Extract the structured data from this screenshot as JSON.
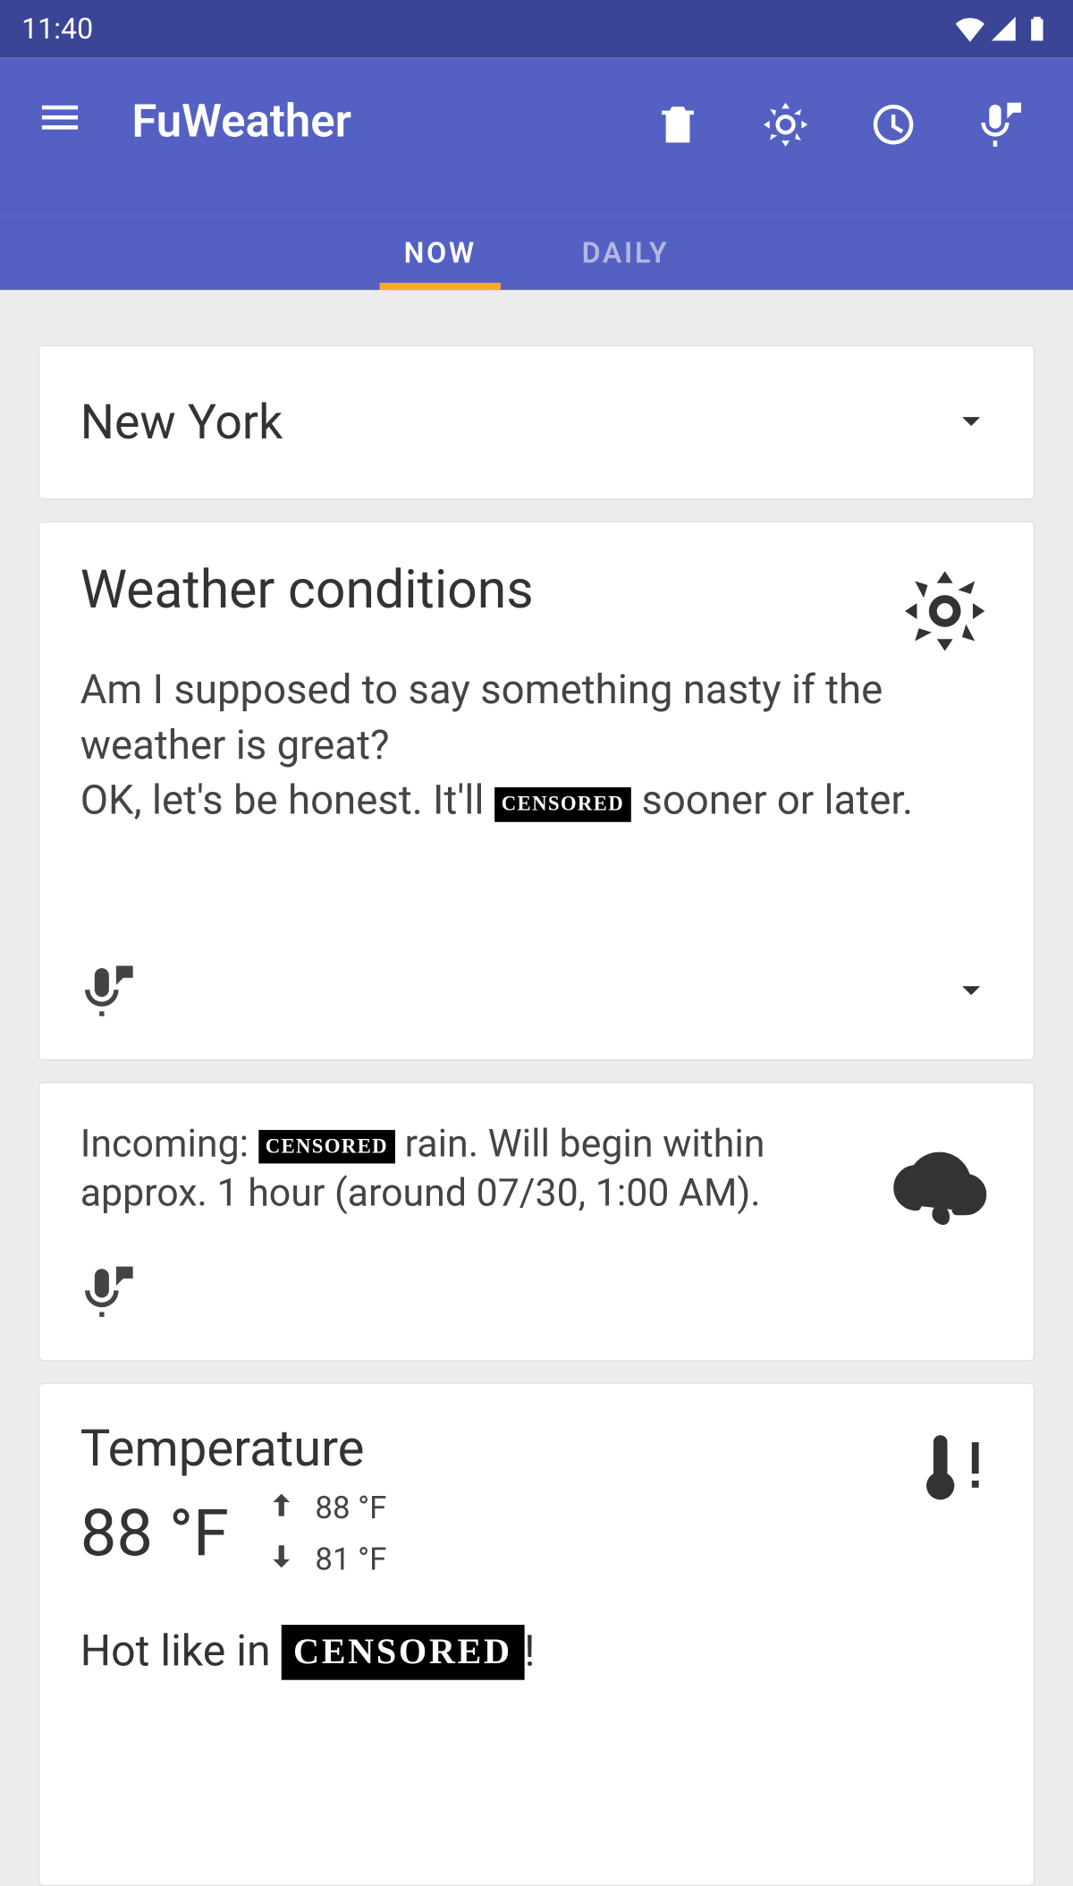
{
  "status": {
    "time": "11:40"
  },
  "app": {
    "title": "FuWeather"
  },
  "tabs": {
    "now": "NOW",
    "daily": "DAILY"
  },
  "location": {
    "name": "New York"
  },
  "conditions": {
    "title": "Weather conditions",
    "line1": "Am I supposed to say something nasty if the weather is great?",
    "line2a": "OK, let's be honest. It'll ",
    "censored": "CENSORED",
    "line2b": " sooner or later."
  },
  "rain": {
    "prefix": "Incoming: ",
    "censored": "CENSORED",
    "suffix": " rain. Will begin within approx. 1 hour (around 07/30, 1:00 AM)."
  },
  "temp": {
    "title": "Temperature",
    "current": "88 °F",
    "high": "88 °F",
    "low": "81 °F",
    "comment_a": "Hot like in ",
    "censored": "CENSORED",
    "comment_b": "!"
  }
}
